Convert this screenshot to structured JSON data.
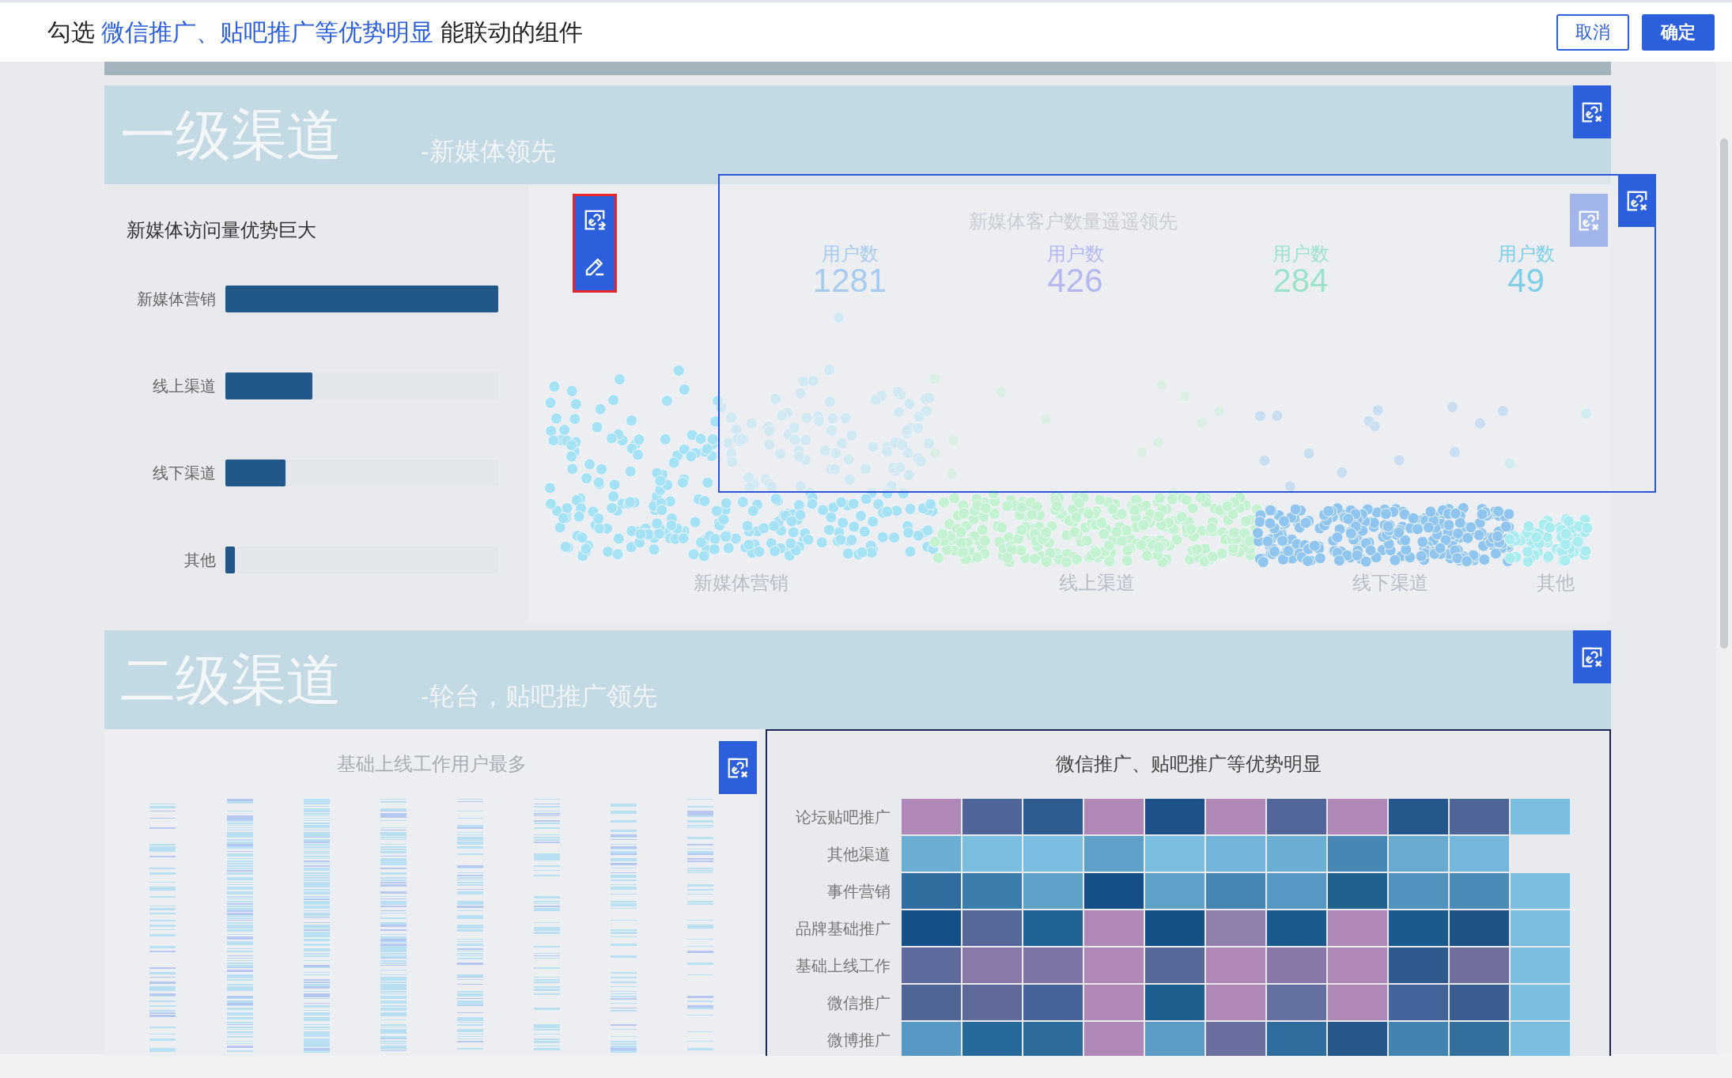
{
  "header": {
    "prompt_before": "勾选",
    "prompt_highlight": "微信推广、贴吧推广等优势明显",
    "prompt_after": "能联动的组件",
    "buttons": [
      {
        "label": "取消",
        "kind": "outline"
      },
      {
        "label": "确定",
        "kind": "primary"
      }
    ]
  },
  "section_1": {
    "title": "一级渠道",
    "subtitle": "-新媒体领先",
    "bar_panel": {
      "title": "新媒体访问量优势巨大",
      "bars": [
        {
          "label": "新媒体营销",
          "level": 1
        },
        {
          "label": "线上渠道",
          "level": 0.32
        },
        {
          "label": "线下渠道",
          "level": 0.22
        },
        {
          "label": "其他",
          "level": 0.035
        }
      ]
    },
    "scatter_panel": {
      "categories": [
        "新媒体营销",
        "线上渠道",
        "线下渠道",
        "其他"
      ]
    },
    "overlay_panel": {
      "title": "新媒体客户数量遥遥领先",
      "stats": [
        {
          "label": "用户数",
          "value": "1281",
          "color": "#a8ccf0"
        },
        {
          "label": "用户数",
          "value": "426",
          "color": "#b6b8f2"
        },
        {
          "label": "用户数",
          "value": "284",
          "color": "#9de3cc"
        },
        {
          "label": "用户数",
          "value": "49",
          "color": "#7fcfe8"
        }
      ]
    }
  },
  "section_2": {
    "title": "二级渠道",
    "subtitle": "-轮台，贴吧推广领先",
    "strip_panel": {
      "title": "基础上线工作用户最多"
    },
    "heatmap_panel": {
      "title": "微信推广、贴吧推广等优势明显",
      "rows": [
        {
          "label": "论坛贴吧推广",
          "cells": [
            {
              "color": "#b088b8"
            },
            {
              "color": "#50659a"
            },
            {
              "color": "#2e5b90"
            },
            {
              "color": "#b088b8"
            },
            {
              "color": "#1e5189"
            },
            {
              "color": "#b088b8"
            },
            {
              "color": "#536699"
            },
            {
              "color": "#b088b8"
            },
            {
              "color": "#26578c"
            },
            {
              "color": "#4f6598"
            },
            {
              "color": "#7bbfe0"
            }
          ]
        },
        {
          "label": "其他渠道",
          "cells": [
            {
              "color": "#6aaed3"
            },
            {
              "color": "#7bbfe0"
            },
            {
              "color": "#7abde0"
            },
            {
              "color": "#5ea1c8"
            },
            {
              "color": "#7bbfe0"
            },
            {
              "color": "#73b5da"
            },
            {
              "color": "#6aaed3"
            },
            {
              "color": "#4787b5"
            },
            {
              "color": "#68aad0"
            },
            {
              "color": "#73b7dc"
            }
          ]
        },
        {
          "label": "事件营销",
          "cells": [
            {
              "color": "#2e6d9d"
            },
            {
              "color": "#3b7eab"
            },
            {
              "color": "#5fa2c9"
            },
            {
              "color": "#164f87"
            },
            {
              "color": "#5ea1c8"
            },
            {
              "color": "#4586b3"
            },
            {
              "color": "#5799c4"
            },
            {
              "color": "#20618f"
            },
            {
              "color": "#5193be"
            },
            {
              "color": "#4a8bb7"
            },
            {
              "color": "#7bbfe0"
            }
          ]
        },
        {
          "label": "品牌基础推广",
          "cells": [
            {
              "color": "#154f87"
            },
            {
              "color": "#56679a"
            },
            {
              "color": "#1f6394"
            },
            {
              "color": "#b088b8"
            },
            {
              "color": "#135085"
            },
            {
              "color": "#917fae"
            },
            {
              "color": "#1a5a8c"
            },
            {
              "color": "#b088b8"
            },
            {
              "color": "#1a5a8c"
            },
            {
              "color": "#1f5287"
            },
            {
              "color": "#7bbfe0"
            }
          ]
        },
        {
          "label": "基础上线工作",
          "cells": [
            {
              "color": "#5f6b9d"
            },
            {
              "color": "#8a78a9"
            },
            {
              "color": "#7c75a5"
            },
            {
              "color": "#b088b8"
            },
            {
              "color": "#586899"
            },
            {
              "color": "#b088b8"
            },
            {
              "color": "#8877a8"
            },
            {
              "color": "#b088b8"
            },
            {
              "color": "#2f5a8e"
            },
            {
              "color": "#716fa0"
            },
            {
              "color": "#7bbfe0"
            }
          ]
        },
        {
          "label": "微信推广",
          "cells": [
            {
              "color": "#4e6596"
            },
            {
              "color": "#5f6a9b"
            },
            {
              "color": "#46649a"
            },
            {
              "color": "#b088b8"
            },
            {
              "color": "#1d5f8f"
            },
            {
              "color": "#b088b8"
            },
            {
              "color": "#6470a0"
            },
            {
              "color": "#b088b8"
            },
            {
              "color": "#43649a"
            },
            {
              "color": "#3a5e92"
            },
            {
              "color": "#7bbfe0"
            }
          ]
        },
        {
          "label": "微博推广",
          "cells": [
            {
              "color": "#5599c4"
            },
            {
              "color": "#266a9b"
            },
            {
              "color": "#2d6b9a"
            },
            {
              "color": "#b088b8"
            },
            {
              "color": "#5a9cc6"
            },
            {
              "color": "#6b6f9f"
            },
            {
              "color": "#2e6d9d"
            },
            {
              "color": "#27578b"
            },
            {
              "color": "#4284b1"
            },
            {
              "color": "#326f9d"
            },
            {
              "color": "#7bbfe0"
            }
          ]
        }
      ]
    }
  }
}
